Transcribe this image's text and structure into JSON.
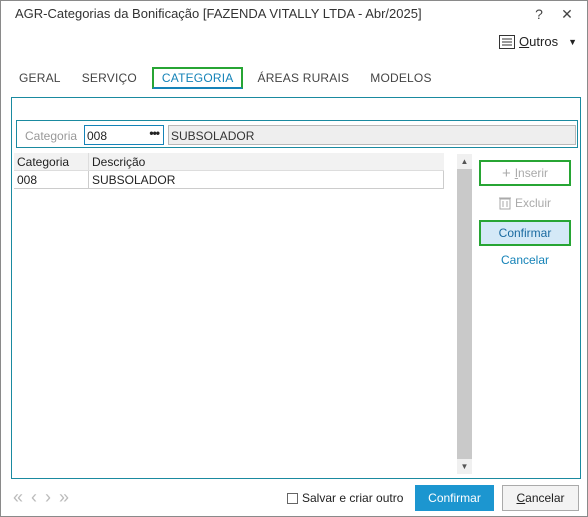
{
  "window": {
    "title": "AGR-Categorias da Bonificação [FAZENDA VITALLY LTDA - Abr/2025]",
    "help_label": "?",
    "close_label": "✕"
  },
  "toolbar": {
    "outros_label": "Outros",
    "outros_icon": "list-icon"
  },
  "tabs": [
    {
      "label": "GERAL"
    },
    {
      "label": "SERVIÇO"
    },
    {
      "label": "CATEGORIA"
    },
    {
      "label": "ÁREAS RURAIS"
    },
    {
      "label": "MODELOS"
    }
  ],
  "filter": {
    "label": "Categoria",
    "code_value": "008",
    "lookup_label": "•••",
    "description_value": "SUBSOLADOR"
  },
  "grid": {
    "headers": [
      "Categoria",
      "Descrição"
    ],
    "rows": [
      {
        "categoria": "008",
        "descricao": "SUBSOLADOR"
      }
    ]
  },
  "actions": {
    "inserir_label": "Inserir",
    "excluir_label": "Excluir",
    "confirmar_label": "Confirmar",
    "cancelar_label": "Cancelar"
  },
  "footer": {
    "nav_first": "«",
    "nav_prev": "‹",
    "nav_next": "›",
    "nav_last": "»",
    "save_new_label": "Salvar e criar outro",
    "confirm_label": "Confirmar",
    "cancel_label": "Cancelar"
  },
  "colors": {
    "accent": "#1c96d0",
    "highlight": "#27a534",
    "panel_border": "#1a8aa0"
  }
}
